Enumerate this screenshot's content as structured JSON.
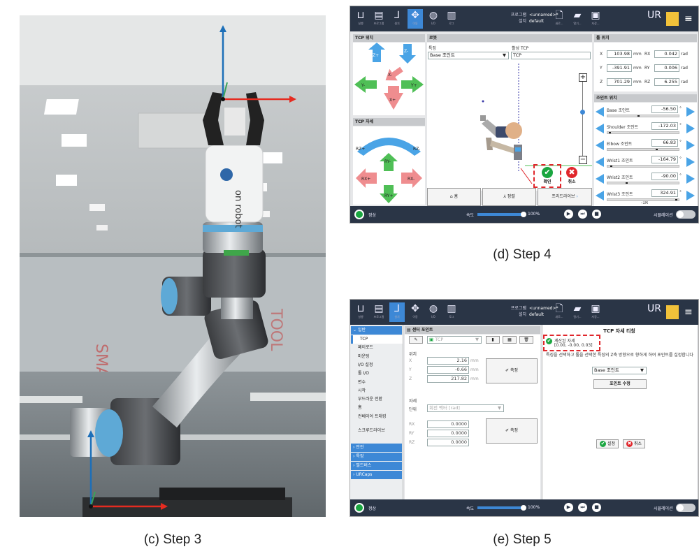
{
  "captions": {
    "c": "(c) Step 3",
    "d": "(d) Step 4",
    "e": "(e) Step 5"
  },
  "photo": {
    "logo": "on robot"
  },
  "step4": {
    "topbar": {
      "prog_label": "프로그램",
      "prog_value": "<unnamed>*",
      "install_label": "설치",
      "install_value": "default",
      "icons": [
        "실행",
        "프로그램",
        "설치",
        "이동",
        "I/O",
        "로그"
      ],
      "file_icons": [
        "새로...",
        "열기...",
        "저장..."
      ]
    },
    "tcp_pos_title": "TCP 위치",
    "tcp_orient_title": "TCP 자세",
    "pos_arrows": [
      "Z+",
      "Z-",
      "X-",
      "Y-",
      "Y+",
      "X+"
    ],
    "orient_arrows": [
      "RZ+",
      "RZ-",
      "RY-",
      "RX+",
      "RX-",
      "RY+"
    ],
    "robot_title": "로봇",
    "feature_label": "특징",
    "feature_value": "Base 조인트",
    "active_tcp_label": "활성 TCP",
    "active_tcp_value": "TCP",
    "confirm_label": "확인",
    "cancel_label": "취소",
    "bottom_buttons": [
      "홈",
      "정렬",
      "프리드라이브"
    ],
    "tool_pos_title": "툴 위치",
    "tool_pos": [
      {
        "axis": "X",
        "value": "103.98",
        "unit": "mm",
        "raxis": "RX",
        "rvalue": "0.042",
        "runit": "rad"
      },
      {
        "axis": "Y",
        "value": "-391.91",
        "unit": "mm",
        "raxis": "RY",
        "rvalue": "0.006",
        "runit": "rad"
      },
      {
        "axis": "Z",
        "value": "701.29",
        "unit": "mm",
        "raxis": "RZ",
        "rvalue": "6.255",
        "runit": "rad"
      }
    ],
    "joint_pos_title": "조인트 위치",
    "joints": [
      {
        "name": "Base 조인트",
        "value": "-56.50",
        "unit": "°",
        "level": 0.42
      },
      {
        "name": "Shoulder 조인트",
        "value": "-172.03",
        "unit": "°",
        "level": 0.02
      },
      {
        "name": "Elbow 조인트",
        "value": "66.83",
        "unit": "°",
        "level": 0.68
      },
      {
        "name": "Wrist1 조인트",
        "value": "-164.79",
        "unit": "°",
        "level": 0.04
      },
      {
        "name": "Wrist2 조인트",
        "value": "-90.00",
        "unit": "°",
        "level": 0.25
      },
      {
        "name": "Wrist3 조인트",
        "value": "324.91",
        "unit": "°",
        "level": 0.95
      }
    ],
    "joint_footer": "-1R",
    "status": "정상",
    "speed_label": "속도",
    "speed_value": "100%",
    "sim_label": "시뮬레이션"
  },
  "step5": {
    "topbar": {
      "prog_label": "프로그램",
      "prog_value": "<unnamed>*",
      "install_label": "설치",
      "install_value": "default",
      "icons": [
        "실행",
        "프로그램",
        "설치",
        "이동",
        "I/O",
        "로그"
      ],
      "file_icons": [
        "새로...",
        "열기...",
        "저장..."
      ]
    },
    "nav_general": "일반",
    "nav_items": [
      "TCP",
      "페이로드",
      "마운팅",
      "I/O 설정",
      "툴 I/O",
      "변수",
      "시작",
      "부드러운 전환",
      "홈",
      "컨베이어 트래킹",
      "스크루드라이브"
    ],
    "nav_sections": [
      "안전",
      "특징",
      "필드버스",
      "URCaps"
    ],
    "center_title": "센터 포인트",
    "tcp_select": "TCP",
    "position_label": "위치",
    "pos_fields": [
      {
        "axis": "X",
        "value": "2.16",
        "unit": "mm"
      },
      {
        "axis": "Y",
        "value": "-0.66",
        "unit": "mm"
      },
      {
        "axis": "Z",
        "value": "217.82",
        "unit": "mm"
      }
    ],
    "measure_label": "측정",
    "orientation_label": "자세",
    "unit_label": "단위",
    "unit_value": "회전 벡터 [rad]",
    "rot_fields": [
      {
        "axis": "RX",
        "value": "0.0000"
      },
      {
        "axis": "RY",
        "value": "0.0000"
      },
      {
        "axis": "RZ",
        "value": "0.0000"
      }
    ],
    "teach_title": "TCP 자세 티칭",
    "calc_label": "계산된 자세",
    "calc_value": "[0.00, -0.00, 0.03]",
    "instruction": "특징을 선택하고 툴을 선택한 특징의 Z축 방향으로 향하게 하여 포인트를 설정합니다",
    "feature_value": "Base 조인트",
    "modify_point": "포인트 수정",
    "set_label": "설정",
    "cancel_label": "취소",
    "status": "정상",
    "speed_label": "속도",
    "speed_value": "100%",
    "sim_label": "시뮬레이션"
  },
  "colors": {
    "topbar": "#2a3546",
    "accent": "#3d88d6",
    "arrow_blue": "#4aa4e6",
    "arrow_red": "#ef8d8f",
    "arrow_green": "#4fbf56",
    "ok": "#1aa640",
    "cancel": "#e0262b",
    "highlight": "#e0262b"
  }
}
